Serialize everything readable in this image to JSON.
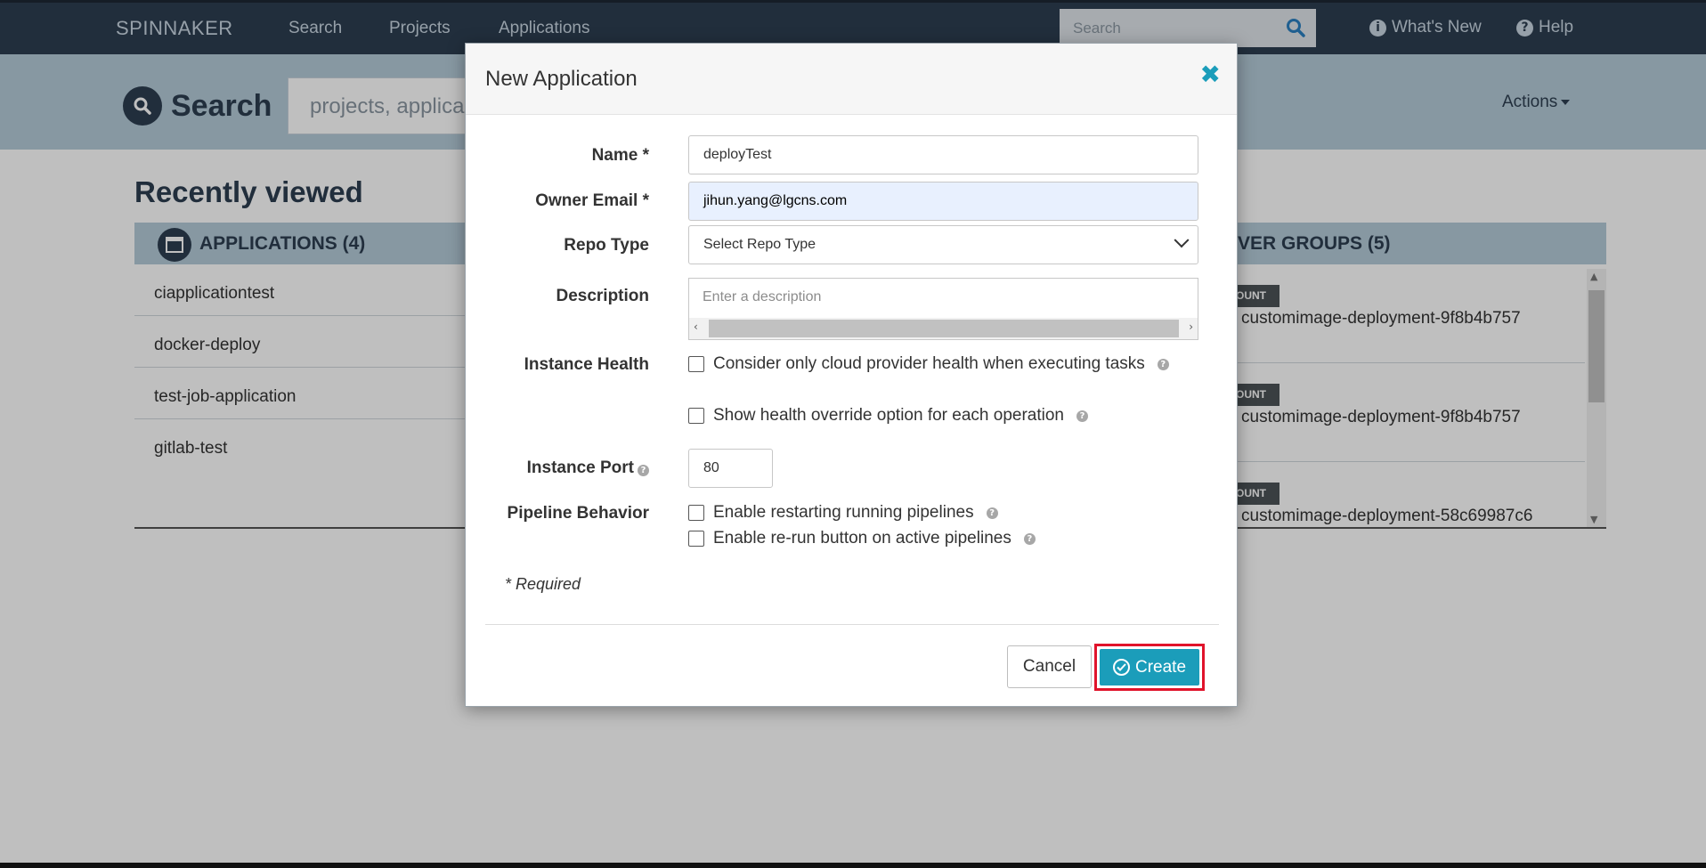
{
  "nav": {
    "brand": "SPINNAKER",
    "links": [
      "Search",
      "Projects",
      "Applications"
    ],
    "search_placeholder": "Search",
    "whats_new": "What's New",
    "help": "Help"
  },
  "header": {
    "title": "Search",
    "search_placeholder": "projects, applica",
    "actions": "Actions"
  },
  "recent": {
    "title": "Recently viewed",
    "applications_header": "APPLICATIONS (4)",
    "applications": [
      "ciapplicationtest",
      "docker-deploy",
      "test-job-application",
      "gitlab-test"
    ],
    "server_groups_header": "VER GROUPS (5)",
    "server_groups": [
      {
        "badge": "OUNT",
        "name": "customimage-deployment-9f8b4b757"
      },
      {
        "badge": "OUNT",
        "name": "customimage-deployment-9f8b4b757"
      },
      {
        "badge": "OUNT",
        "name": "customimage-deployment-58c69987c6"
      }
    ]
  },
  "modal": {
    "title": "New Application",
    "fields": {
      "name_label": "Name *",
      "name_value": "deployTest",
      "email_label": "Owner Email *",
      "email_value": "jihun.yang@lgcns.com",
      "repo_label": "Repo Type",
      "repo_value": "Select Repo Type",
      "description_label": "Description",
      "description_placeholder": "Enter a description",
      "health_label": "Instance Health",
      "health_opt1": "Consider only cloud provider health when executing tasks",
      "health_opt2": "Show health override option for each operation",
      "port_label": "Instance Port",
      "port_value": "80",
      "pipeline_label": "Pipeline Behavior",
      "pipeline_opt1": "Enable restarting running pipelines",
      "pipeline_opt2": "Enable re-run button on active pipelines"
    },
    "required_note": "* Required",
    "cancel": "Cancel",
    "create": "Create"
  },
  "colors": {
    "nav_bg": "#2d3e50",
    "band_bg": "#b5cbd9",
    "accent": "#1b9dba",
    "highlight_border": "#e0132b"
  }
}
